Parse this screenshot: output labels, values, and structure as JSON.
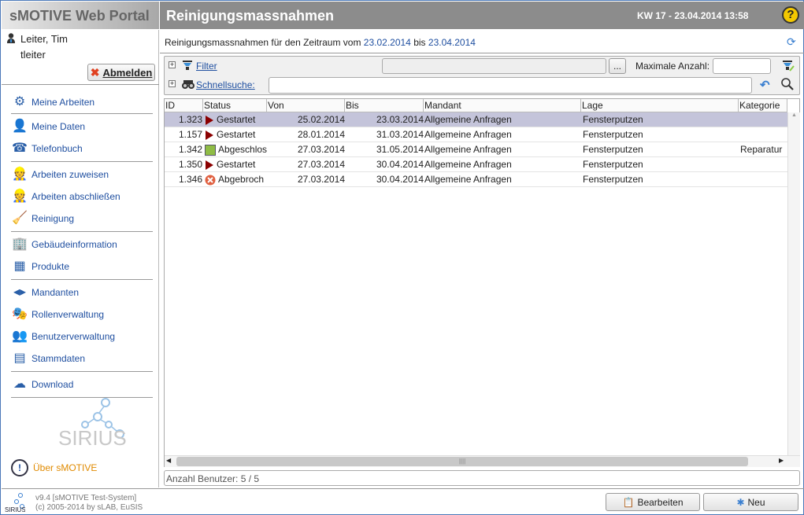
{
  "app_title": "sMOTIVE Web Portal",
  "page_title": "Reinigungsmassnahmen",
  "week_datetime": "KW 17 - 23.04.2014 13:58",
  "help_label": "?",
  "user": {
    "name": "Leiter, Tim",
    "login": "tleiter",
    "logout_label": "Abmelden"
  },
  "sidebar": {
    "items": [
      {
        "label": "Meine Arbeiten",
        "icon": "gears-icon"
      },
      {
        "label": "Meine Daten",
        "icon": "user-icon"
      },
      {
        "label": "Telefonbuch",
        "icon": "phonebook-icon"
      },
      {
        "label": "Arbeiten zuweisen",
        "icon": "worker-assign-icon"
      },
      {
        "label": "Arbeiten abschließen",
        "icon": "worker-complete-icon"
      },
      {
        "label": "Reinigung",
        "icon": "cleaning-icon"
      },
      {
        "label": "Gebäudeinformation",
        "icon": "building-icon"
      },
      {
        "label": "Produkte",
        "icon": "products-icon"
      },
      {
        "label": "Mandanten",
        "icon": "clients-icon"
      },
      {
        "label": "Rollenverwaltung",
        "icon": "masks-icon"
      },
      {
        "label": "Benutzerverwaltung",
        "icon": "users-icon"
      },
      {
        "label": "Stammdaten",
        "icon": "database-icon"
      },
      {
        "label": "Download",
        "icon": "cloud-download-icon"
      }
    ],
    "logo_text": "SIRIUS",
    "about_label": "Über sMOTIVE"
  },
  "main": {
    "period_prefix": "Reinigungsmassnahmen für den Zeitraum vom",
    "date_from": "23.02.2014",
    "period_mid": "bis",
    "date_to": "23.04.2014",
    "filter_label": "Filter",
    "filter_value": "",
    "browse_label": "...",
    "max_label": "Maximale Anzahl:",
    "max_value": "",
    "quicksearch_label": "Schnellsuche:",
    "quicksearch_value": "",
    "columns": [
      "ID",
      "Status",
      "Von",
      "Bis",
      "Mandant",
      "Lage",
      "Kategorie"
    ],
    "rows": [
      {
        "id": "1.323",
        "status": "Gestartet",
        "status_icon": "play",
        "von": "25.02.2014",
        "bis": "23.03.2014",
        "mandant": "Allgemeine Anfragen",
        "lage": "Fensterputzen",
        "kategorie": ""
      },
      {
        "id": "1.157",
        "status": "Gestartet",
        "status_icon": "play",
        "von": "28.01.2014",
        "bis": "31.03.2014",
        "mandant": "Allgemeine Anfragen",
        "lage": "Fensterputzen",
        "kategorie": ""
      },
      {
        "id": "1.342",
        "status": "Abgeschlos",
        "status_icon": "done",
        "von": "27.03.2014",
        "bis": "31.05.2014",
        "mandant": "Allgemeine Anfragen",
        "lage": "Fensterputzen",
        "kategorie": "Reparatur"
      },
      {
        "id": "1.350",
        "status": "Gestartet",
        "status_icon": "play",
        "von": "27.03.2014",
        "bis": "30.04.2014",
        "mandant": "Allgemeine Anfragen",
        "lage": "Fensterputzen",
        "kategorie": ""
      },
      {
        "id": "1.346",
        "status": "Abgebroch",
        "status_icon": "cancel",
        "von": "27.03.2014",
        "bis": "30.04.2014",
        "mandant": "Allgemeine Anfragen",
        "lage": "Fensterputzen",
        "kategorie": ""
      }
    ],
    "status_text": "Anzahl Benutzer: 5 / 5"
  },
  "footer": {
    "version": "v9.4 [sMOTIVE Test-System]",
    "copyright": "(c) 2005-2014 by sLAB, EuSIS",
    "edit_label": "Bearbeiten",
    "new_label": "Neu"
  },
  "colors": {
    "accent": "#1f4fa0",
    "selected_row": "#c4c4da",
    "about": "#e08a00",
    "play": "#8b0000",
    "done": "#8fbc45",
    "cancel": "#e06040"
  }
}
